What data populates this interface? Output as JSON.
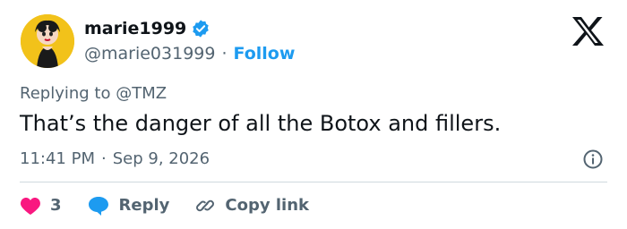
{
  "author": {
    "display_name": "marie1999",
    "handle": "@marie031999",
    "separator": "·",
    "follow_label": "Follow",
    "avatar_icon": "betty-boop-avatar",
    "verified_icon": "verified-badge-icon"
  },
  "brand": {
    "logo": "x-logo-icon"
  },
  "reply_context": {
    "prefix": "Replying to",
    "mention": "@TMZ"
  },
  "tweet": {
    "text": "That’s the danger of all the Botox and fillers.",
    "time": "11:41 PM",
    "separator": "·",
    "date": "Sep 9, 2026"
  },
  "actions": {
    "like_count": "3",
    "reply_label": "Reply",
    "copy_link_label": "Copy link"
  },
  "colors": {
    "text": "#0f1419",
    "muted": "#536471",
    "accent": "#1d9bf0",
    "like": "#f91880",
    "divider": "#cfd9de"
  }
}
